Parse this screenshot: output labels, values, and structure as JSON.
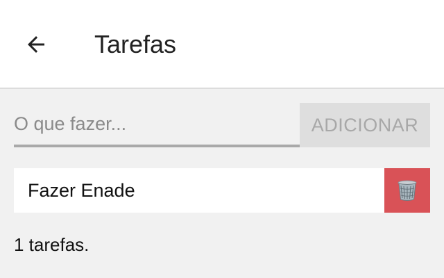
{
  "header": {
    "back_icon": "arrow-left-icon",
    "title": "Tarefas"
  },
  "form": {
    "input_value": "",
    "input_placeholder": "O que fazer...",
    "add_label": "ADICIONAR"
  },
  "tasks": [
    {
      "label": "Fazer Enade",
      "delete_icon": "trash-can-icon"
    }
  ],
  "footer": {
    "count_text": "1 tarefas."
  },
  "colors": {
    "header_bg": "#ffffff",
    "page_bg": "#f1f1f1",
    "add_button_bg": "#dedede",
    "delete_button_bg": "#d95257"
  }
}
